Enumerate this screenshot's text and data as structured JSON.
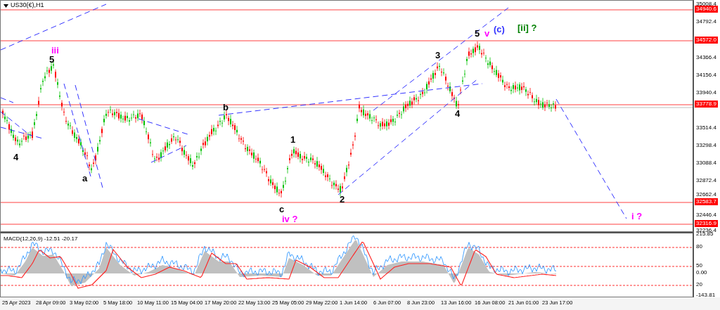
{
  "window": {
    "title": "US30(€),H1"
  },
  "price_axis": {
    "ticks": [
      "35008.4",
      "34792.4",
      "34366.4",
      "34156.4",
      "33940.4",
      "33514.4",
      "33298.4",
      "33088.4",
      "32872.4",
      "32662.4",
      "32446.4",
      "32236.4"
    ]
  },
  "price_tags": [
    {
      "label": "34940.6"
    },
    {
      "label": "34572.0"
    },
    {
      "label": "33778.9"
    },
    {
      "label": "32583.7"
    },
    {
      "label": "32316.9"
    }
  ],
  "wave_labels": [
    {
      "text": "4",
      "color": "#000000"
    },
    {
      "text": "5",
      "color": "#000000"
    },
    {
      "text": "iii",
      "color": "#ff00ff"
    },
    {
      "text": "a",
      "color": "#000000"
    },
    {
      "text": "b",
      "color": "#000000"
    },
    {
      "text": "1",
      "color": "#000000"
    },
    {
      "text": "c",
      "color": "#000000"
    },
    {
      "text": "iv ?",
      "color": "#ff00ff"
    },
    {
      "text": "2",
      "color": "#000000"
    },
    {
      "text": "3",
      "color": "#000000"
    },
    {
      "text": "4",
      "color": "#000000"
    },
    {
      "text": "5",
      "color": "#000000"
    },
    {
      "text": "v",
      "color": "#ff00ff"
    },
    {
      "text": "(c)",
      "color": "#3333ff"
    },
    {
      "text": "[ii] ?",
      "color": "#008000"
    },
    {
      "text": "i ?",
      "color": "#ff00ff"
    }
  ],
  "macd": {
    "title": "MACD(12,26,9) -12.51 -20.17",
    "axis_labels": [
      "215.85",
      "80",
      "50",
      "0.00",
      "20",
      "-143.81"
    ]
  },
  "time_axis": {
    "labels": [
      "25 Apr 2023",
      "28 Apr 09:00",
      "3 May 02:00",
      "5 May 18:00",
      "10 May 11:00",
      "15 May 04:00",
      "17 May 20:00",
      "22 May 13:00",
      "25 May 05:00",
      "29 May 22:00",
      "1 Jun 14:00",
      "6 Jun 07:00",
      "8 Jun 23:00",
      "13 Jun 16:00",
      "16 Jun 08:00",
      "21 Jun 01:00",
      "23 Jun 17:00"
    ]
  }
}
